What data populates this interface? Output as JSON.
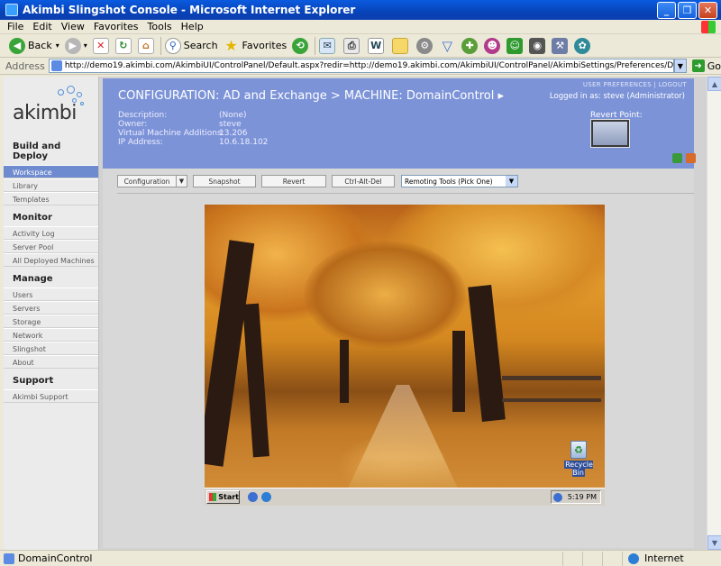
{
  "window": {
    "title": "Akimbi Slingshot Console - Microsoft Internet Explorer",
    "buttons": [
      "_",
      "❐",
      "✕"
    ]
  },
  "menu": [
    "File",
    "Edit",
    "View",
    "Favorites",
    "Tools",
    "Help"
  ],
  "toolbar": {
    "back_label": "Back",
    "search_label": "Search",
    "favorites_label": "Favorites"
  },
  "address": {
    "label": "Address",
    "url": "http://demo19.akimbi.com/AkimbiUI/ControlPanel/Default.aspx?redir=http://demo19.akimbi.com/AkimbiUI/ControlPanel/AkimbiSettings/Preferences/Default.aspx",
    "go_label": "Go"
  },
  "sidebar": {
    "logo": "akimbi",
    "sections": [
      {
        "title": "Build and Deploy",
        "items": [
          {
            "label": "Workspace",
            "active": true
          },
          {
            "label": "Library"
          },
          {
            "label": "Templates"
          }
        ]
      },
      {
        "title": "Monitor",
        "items": [
          {
            "label": "Activity Log"
          },
          {
            "label": "Server Pool"
          },
          {
            "label": "All Deployed Machines"
          }
        ]
      },
      {
        "title": "Manage",
        "items": [
          {
            "label": "Users"
          },
          {
            "label": "Servers"
          },
          {
            "label": "Storage"
          },
          {
            "label": "Network"
          },
          {
            "label": "Slingshot"
          },
          {
            "label": "About"
          }
        ]
      },
      {
        "title": "Support",
        "items": [
          {
            "label": "Akimbi Support"
          }
        ]
      }
    ]
  },
  "header": {
    "machine_title": "CONFIGURATION: AD and Exchange  > MACHINE: DomainControl ▸",
    "user_links": "USER PREFERENCES  |  LOGOUT",
    "logged_in": "Logged in as: steve (Administrator)",
    "revert_point_label": "Revert Point:",
    "fields": [
      {
        "label": "Description:",
        "value": "(None)"
      },
      {
        "label": "Owner:",
        "value": "steve"
      },
      {
        "label": "Virtual Machine Additions:",
        "value": "13.206"
      },
      {
        "label": "IP Address:",
        "value": "10.6.18.102"
      }
    ]
  },
  "actions": {
    "configuration_label": "Configuration",
    "snapshot_label": "Snapshot",
    "revert_label": "Revert",
    "ctrl_alt_del_label": "Ctrl-Alt-Del",
    "remoting_tools_selected": "Remoting Tools (Pick One)"
  },
  "remote_desktop": {
    "recycle_bin_label": "Recycle Bin",
    "start_label": "Start",
    "clock": "5:19 PM"
  },
  "status": {
    "text": "DomainControl",
    "zone": "Internet"
  }
}
